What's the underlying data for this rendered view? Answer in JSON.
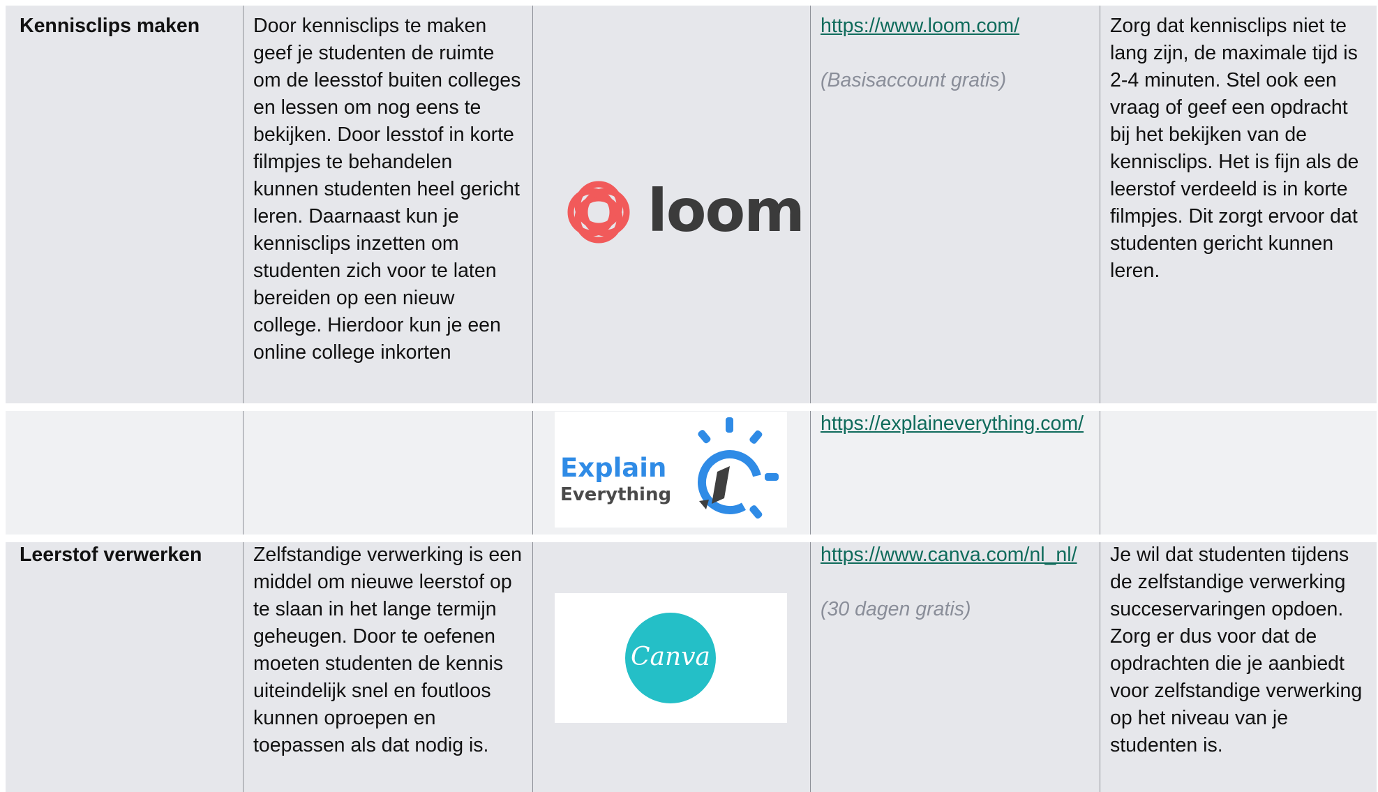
{
  "rows": [
    {
      "topic": "Kennisclips maken",
      "description": "Door kennisclips te maken geef je studenten de ruimte om de leesstof buiten colleges en lessen om nog eens te bekijken. Door lesstof in korte filmpjes te behandelen kunnen studenten heel gericht leren. Daarnaast kun je kennisclips inzetten om studenten zich voor te laten bereiden op een nieuw college. Hierdoor kun je een online college inkorten",
      "logo": {
        "icon": "loom-logo",
        "text": "loom"
      },
      "link": "https://www.loom.com/",
      "note": "(Basisaccount gratis)",
      "tip": "Zorg dat kennisclips niet te lang zijn, de maximale tijd is 2-4 minuten. Stel ook een vraag of geef een opdracht bij het bekijken van de kennisclips. Het is fijn als de leerstof verdeeld is in korte filmpjes. Dit zorgt ervoor dat studenten gericht kunnen leren."
    },
    {
      "topic": "",
      "description": "",
      "logo": {
        "icon": "explain-everything-logo",
        "text1": "Explain",
        "text2": "Everything"
      },
      "link": "https://explaineverything.com/",
      "note": "",
      "tip": ""
    },
    {
      "topic": "Leerstof verwerken",
      "description": "Zelfstandige verwerking is een middel om nieuwe leerstof op te slaan in het lange termijn geheugen. Door te oefenen moeten studenten de kennis uiteindelijk snel en foutloos kunnen oproepen en toepassen als dat nodig is.",
      "logo": {
        "icon": "canva-logo",
        "text": "Canva"
      },
      "link": "https://www.canva.com/nl_nl/",
      "note": "(30 dagen gratis)",
      "tip": "Je wil dat studenten tijdens de zelfstandige verwerking succeservaringen opdoen. Zorg er dus voor dat de opdrachten die je aanbiedt voor zelfstandige verwerking op het niveau van je studenten is."
    }
  ],
  "colors": {
    "link": "#0f6b5b",
    "note": "#8a8e99",
    "loom": "#f15a5a",
    "explain_blue": "#2f8be6",
    "canva": "#24bfc7"
  }
}
